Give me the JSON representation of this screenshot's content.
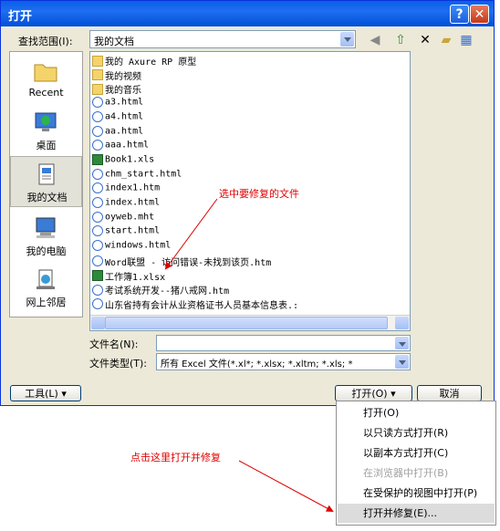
{
  "window": {
    "title": "打开"
  },
  "lookin": {
    "label": "查找范围(I):",
    "value": "我的文档"
  },
  "places": [
    {
      "label": "Recent"
    },
    {
      "label": "桌面"
    },
    {
      "label": "我的文档"
    },
    {
      "label": "我的电脑"
    },
    {
      "label": "网上邻居"
    }
  ],
  "files": [
    {
      "name": "我的 Axure RP 原型",
      "icon": "folder-icon"
    },
    {
      "name": "我的视频",
      "icon": "folder-icon"
    },
    {
      "name": "我的音乐",
      "icon": "folder-icon"
    },
    {
      "name": "a3.html",
      "icon": "html-file-icon"
    },
    {
      "name": "a4.html",
      "icon": "html-file-icon"
    },
    {
      "name": "aa.html",
      "icon": "html-file-icon"
    },
    {
      "name": "aaa.html",
      "icon": "html-file-icon"
    },
    {
      "name": "Book1.xls",
      "icon": "excel-file-icon"
    },
    {
      "name": "chm_start.html",
      "icon": "html-file-icon"
    },
    {
      "name": "index1.htm",
      "icon": "html-file-icon"
    },
    {
      "name": "index.html",
      "icon": "html-file-icon"
    },
    {
      "name": "oyweb.mht",
      "icon": "html-file-icon"
    },
    {
      "name": "start.html",
      "icon": "html-file-icon"
    },
    {
      "name": "windows.html",
      "icon": "html-file-icon"
    },
    {
      "name": "Word联盟 - 访问错误-未找到该页.htm",
      "icon": "html-file-icon"
    },
    {
      "name": "工作簿1.xlsx",
      "icon": "excel-file-icon"
    },
    {
      "name": "考试系统开发--猪八戒网.htm",
      "icon": "html-file-icon"
    },
    {
      "name": "山东省持有会计从业资格证书人员基本信息表.:",
      "icon": "html-file-icon"
    }
  ],
  "filename": {
    "label": "文件名(N):",
    "value": ""
  },
  "filetype": {
    "label": "文件类型(T):",
    "value": "所有 Excel 文件(*.xl*; *.xlsx; *.xltm; *.xls; *"
  },
  "buttons": {
    "tools": "工具(L)",
    "open": "打开(O)",
    "cancel": "取消"
  },
  "open_menu": [
    {
      "label": "打开(O)",
      "enabled": true
    },
    {
      "label": "以只读方式打开(R)",
      "enabled": true
    },
    {
      "label": "以副本方式打开(C)",
      "enabled": true
    },
    {
      "label": "在浏览器中打开(B)",
      "enabled": false
    },
    {
      "label": "在受保护的视图中打开(P)",
      "enabled": true
    },
    {
      "label": "打开并修复(E)...",
      "enabled": true,
      "highlighted": true
    }
  ],
  "annotations": {
    "select": "选中要修复的文件",
    "click": "点击这里打开并修复"
  },
  "colors": {
    "annotation": "#e00000",
    "titlebar": "#0a5fe8"
  }
}
